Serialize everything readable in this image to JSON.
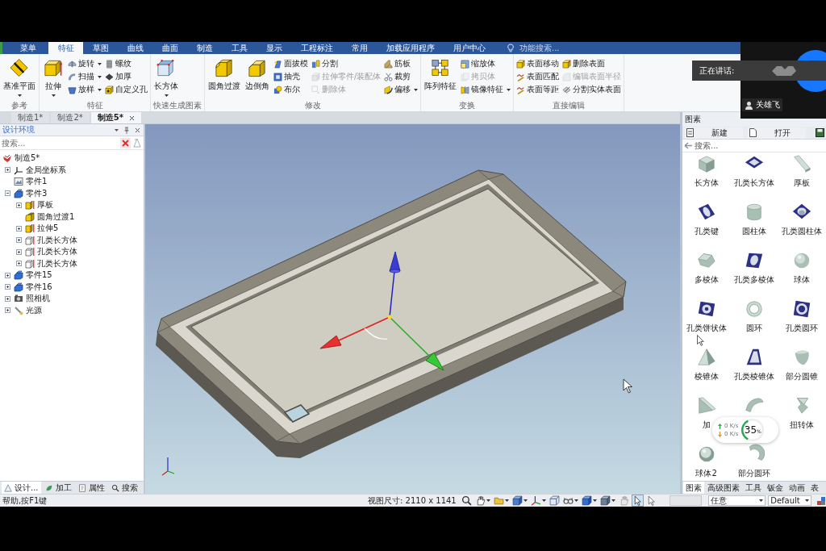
{
  "menu_tabs": [
    {
      "label": "菜单",
      "selected": false
    },
    {
      "label": "特征",
      "selected": true
    },
    {
      "label": "草图",
      "selected": false
    },
    {
      "label": "曲线",
      "selected": false
    },
    {
      "label": "曲面",
      "selected": false
    },
    {
      "label": "制造",
      "selected": false
    },
    {
      "label": "工具",
      "selected": false
    },
    {
      "label": "显示",
      "selected": false
    },
    {
      "label": "工程标注",
      "selected": false
    },
    {
      "label": "常用",
      "selected": false
    },
    {
      "label": "加载应用程序",
      "selected": false
    },
    {
      "label": "用户中心",
      "selected": false
    }
  ],
  "feature_search": {
    "placeholder": "功能搜索..."
  },
  "ribbon_groups": [
    {
      "label": "参考",
      "columns": [
        {
          "kind": "large",
          "label": "基准平面",
          "dropdown": true
        }
      ]
    },
    {
      "label": "特征",
      "columns": [
        {
          "kind": "large",
          "label": "拉伸",
          "dropdown": true
        },
        {
          "kind": "stack",
          "items": [
            {
              "label": "旋转",
              "dropdown": true,
              "disabled": false
            },
            {
              "label": "扫描",
              "dropdown": true,
              "disabled": false
            },
            {
              "label": "放样",
              "dropdown": true,
              "disabled": false
            }
          ]
        },
        {
          "kind": "stack",
          "items": [
            {
              "label": "螺纹",
              "dropdown": false,
              "disabled": false
            },
            {
              "label": "加厚",
              "dropdown": false,
              "disabled": false
            },
            {
              "label": "自定义孔",
              "dropdown": false,
              "disabled": false
            }
          ]
        }
      ]
    },
    {
      "label": "快速生成图素",
      "columns": [
        {
          "kind": "large",
          "label": "长方体",
          "dropdown": true
        }
      ]
    },
    {
      "label": "修改",
      "columns": [
        {
          "kind": "large",
          "label": "圆角过渡",
          "dropdown": false
        },
        {
          "kind": "large",
          "label": "边倒角",
          "dropdown": false
        },
        {
          "kind": "stack",
          "items": [
            {
              "label": "面拔模",
              "dropdown": false,
              "disabled": false
            },
            {
              "label": "抽壳",
              "dropdown": false,
              "disabled": false
            },
            {
              "label": "布尔",
              "dropdown": false,
              "disabled": false
            }
          ]
        },
        {
          "kind": "stack",
          "items": [
            {
              "label": "分割",
              "dropdown": false,
              "disabled": false
            },
            {
              "label": "拉伸零件/装配体",
              "dropdown": false,
              "disabled": true
            },
            {
              "label": "删除体",
              "dropdown": false,
              "disabled": true
            }
          ]
        },
        {
          "kind": "stack",
          "items": [
            {
              "label": "筋板",
              "dropdown": false,
              "disabled": false
            },
            {
              "label": "裁剪",
              "dropdown": false,
              "disabled": false
            },
            {
              "label": "偏移",
              "dropdown": true,
              "disabled": false
            }
          ]
        }
      ]
    },
    {
      "label": "变换",
      "columns": [
        {
          "kind": "large",
          "label": "阵列特征",
          "dropdown": false
        },
        {
          "kind": "stack",
          "items": [
            {
              "label": "缩放体",
              "dropdown": false,
              "disabled": false
            },
            {
              "label": "拷贝体",
              "dropdown": false,
              "disabled": true
            },
            {
              "label": "镜像特征",
              "dropdown": true,
              "disabled": false
            }
          ]
        }
      ]
    },
    {
      "label": "直接编辑",
      "columns": [
        {
          "kind": "stack",
          "items": [
            {
              "label": "表面移动",
              "dropdown": false,
              "disabled": false
            },
            {
              "label": "表面匹配",
              "dropdown": false,
              "disabled": false
            },
            {
              "label": "表面等距",
              "dropdown": false,
              "disabled": false
            }
          ]
        },
        {
          "kind": "stack",
          "items": [
            {
              "label": "删除表面",
              "dropdown": false,
              "disabled": false
            },
            {
              "label": "编辑表面半径",
              "dropdown": false,
              "disabled": true
            },
            {
              "label": "分割实体表面",
              "dropdown": false,
              "disabled": false
            }
          ]
        }
      ]
    }
  ],
  "document_tabs": [
    {
      "label": "制造1*",
      "selected": false
    },
    {
      "label": "制造2*",
      "selected": false
    },
    {
      "label": "制造5*",
      "selected": true
    }
  ],
  "design_panel": {
    "title": "设计环境",
    "search": {
      "placeholder": "搜索..."
    },
    "tree": [
      {
        "label": "制造5*",
        "kind": "assembly",
        "children": [
          {
            "label": "全局坐标系",
            "kind": "axes",
            "expanded": false
          },
          {
            "label": "零件1",
            "kind": "image_part"
          },
          {
            "label": "零件3",
            "kind": "part",
            "expanded": true,
            "children": [
              {
                "label": "厚板",
                "kind": "block_feature",
                "expanded": false
              },
              {
                "label": "圆角过渡1",
                "kind": "fillet_feature"
              },
              {
                "label": "拉伸5",
                "kind": "block_feature",
                "expanded": false
              },
              {
                "label": "孔类长方体",
                "kind": "hole_feature",
                "expanded": false
              },
              {
                "label": "孔类长方体",
                "kind": "hole_feature",
                "expanded": false
              },
              {
                "label": "孔类长方体",
                "kind": "hole_feature",
                "expanded": false
              }
            ]
          },
          {
            "label": "零件15",
            "kind": "part",
            "expanded": false
          },
          {
            "label": "零件16",
            "kind": "part",
            "expanded": false
          },
          {
            "label": "照相机",
            "kind": "camera",
            "expanded": false
          },
          {
            "label": "光源",
            "kind": "light",
            "expanded": false
          }
        ]
      }
    ],
    "tabs": [
      {
        "label": "设计...",
        "selected": true
      },
      {
        "label": "加工",
        "selected": false
      },
      {
        "label": "属性",
        "selected": false
      },
      {
        "label": "搜索",
        "selected": false
      }
    ]
  },
  "library_panel": {
    "title": "图素",
    "toolbar": [
      {
        "label": "新建"
      },
      {
        "label": "打开"
      }
    ],
    "search": {
      "placeholder": "搜索..."
    },
    "items": [
      {
        "label": "长方体",
        "kind": "solid"
      },
      {
        "label": "孔类长方体",
        "kind": "hole"
      },
      {
        "label": "厚板",
        "kind": "solid"
      },
      {
        "label": "孔类键",
        "kind": "hole"
      },
      {
        "label": "圆柱体",
        "kind": "solid"
      },
      {
        "label": "孔类圆柱体",
        "kind": "hole"
      },
      {
        "label": "多棱体",
        "kind": "solid"
      },
      {
        "label": "孔类多棱体",
        "kind": "hole"
      },
      {
        "label": "球体",
        "kind": "solid"
      },
      {
        "label": "孔类饼状体",
        "kind": "hole"
      },
      {
        "label": "圆环",
        "kind": "solid"
      },
      {
        "label": "孔类圆环",
        "kind": "hole"
      },
      {
        "label": "棱锥体",
        "kind": "solid"
      },
      {
        "label": "孔类棱锥体",
        "kind": "hole"
      },
      {
        "label": "部分圆锥",
        "kind": "solid"
      },
      {
        "label": "加",
        "kind": "solid"
      },
      {
        "kind": "solid"
      },
      {
        "label": "扭转体",
        "kind": "solid"
      },
      {
        "label": "球体2",
        "kind": "solid"
      },
      {
        "label": "部分圆环",
        "kind": "solid"
      }
    ],
    "tabs": [
      {
        "label": "图素",
        "selected": true
      },
      {
        "label": "高级图素",
        "selected": false
      },
      {
        "label": "工具",
        "selected": false
      },
      {
        "label": "钣金",
        "selected": false
      },
      {
        "label": "动画",
        "selected": false
      },
      {
        "label": "表",
        "selected": false
      }
    ]
  },
  "status_bar": {
    "help": "帮助,按F1键",
    "view_size": "视图尺寸: 2110 x 1141",
    "tools": [
      {
        "selected": false
      },
      {
        "selected": false
      },
      {
        "selected": false
      },
      {
        "selected": false
      },
      {
        "selected": false
      },
      {
        "selected": false
      },
      {
        "selected": false
      },
      {
        "selected": false
      },
      {
        "selected": false
      },
      {
        "selected": false
      },
      {
        "selected": true
      },
      {
        "selected": false
      }
    ],
    "pick_filter": {
      "value": "任意"
    },
    "style": {
      "value": "Default"
    }
  },
  "meeting_overlay": {
    "speaking_label": "正在讲话:",
    "participant": "关雄飞"
  },
  "network_widget": {
    "upload": "0 K/s",
    "download": "0 K/s",
    "value": "35",
    "unit": "%",
    "level": 0.35
  }
}
